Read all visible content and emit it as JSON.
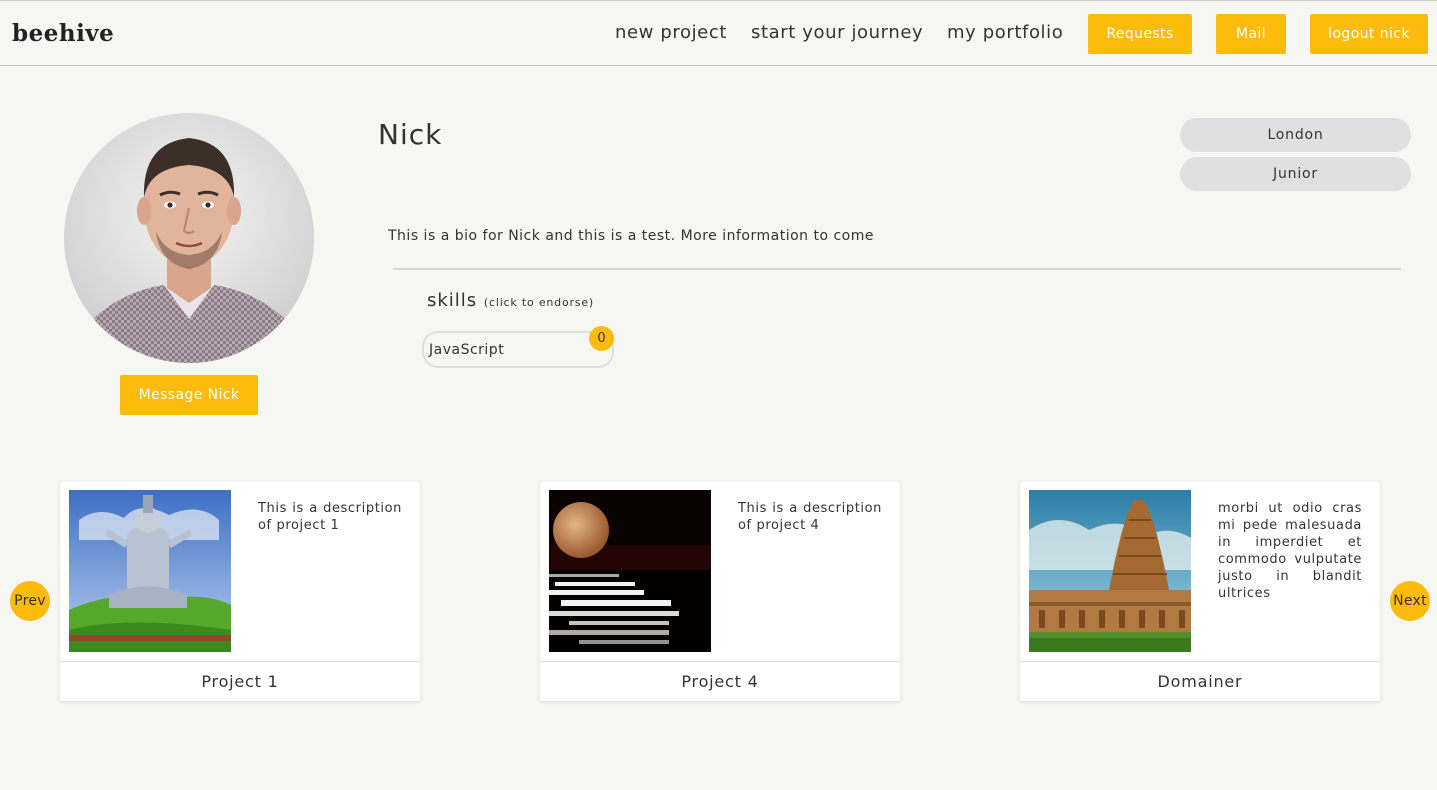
{
  "nav": {
    "brand": "beehive",
    "links": [
      "new project",
      "start your journey",
      "my portfolio"
    ],
    "buttons": [
      "Requests",
      "Mail",
      "logout nick"
    ]
  },
  "profile": {
    "name": "Nick",
    "location": "London",
    "level": "Junior",
    "bio": "This is a bio for Nick and this is a test. More information to come",
    "message_button": "Message Nick"
  },
  "skills": {
    "heading": "skills",
    "hint": "(click to endorse)",
    "items": [
      {
        "name": "JavaScript",
        "endorsements": "0"
      }
    ]
  },
  "projects": [
    {
      "title": "Project 1",
      "description": "This is a description of project 1",
      "image_icon": "statue-photo"
    },
    {
      "title": "Project 4",
      "description": "This is a description of project 4",
      "image_icon": "moon-photo"
    },
    {
      "title": "Domainer",
      "description": "morbi ut odio cras mi pede malesuada in imperdiet et commodo vulputate justo in blandit ultrices",
      "image_icon": "temple-photo"
    }
  ],
  "carousel": {
    "prev": "Prev",
    "next": "Next"
  },
  "colors": {
    "accent": "#fdbb0b",
    "background": "#f6f6f2",
    "pill": "#e0e0e0"
  }
}
